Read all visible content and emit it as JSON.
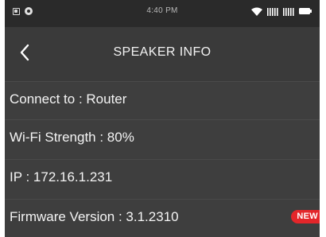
{
  "status_bar": {
    "time": "4:40 PM",
    "icons": [
      "sim-icon",
      "gear-icon",
      "wifi-icon",
      "signal-icon",
      "signal-icon",
      "battery-icon"
    ]
  },
  "header": {
    "back_icon": "chevron-left-icon",
    "title": "SPEAKER INFO"
  },
  "info": {
    "connect_to": "Connect to : Router",
    "wifi_strength": "Wi-Fi Strength : 80%",
    "ip": "IP : 172.16.1.231",
    "firmware": "Firmware Version : 3.1.2310",
    "firmware_badge": "NEW"
  },
  "colors": {
    "background": "#3e3e3e",
    "status_bar": "#2a2a2a",
    "text": "#f4f4f4",
    "badge": "#e3262a"
  }
}
